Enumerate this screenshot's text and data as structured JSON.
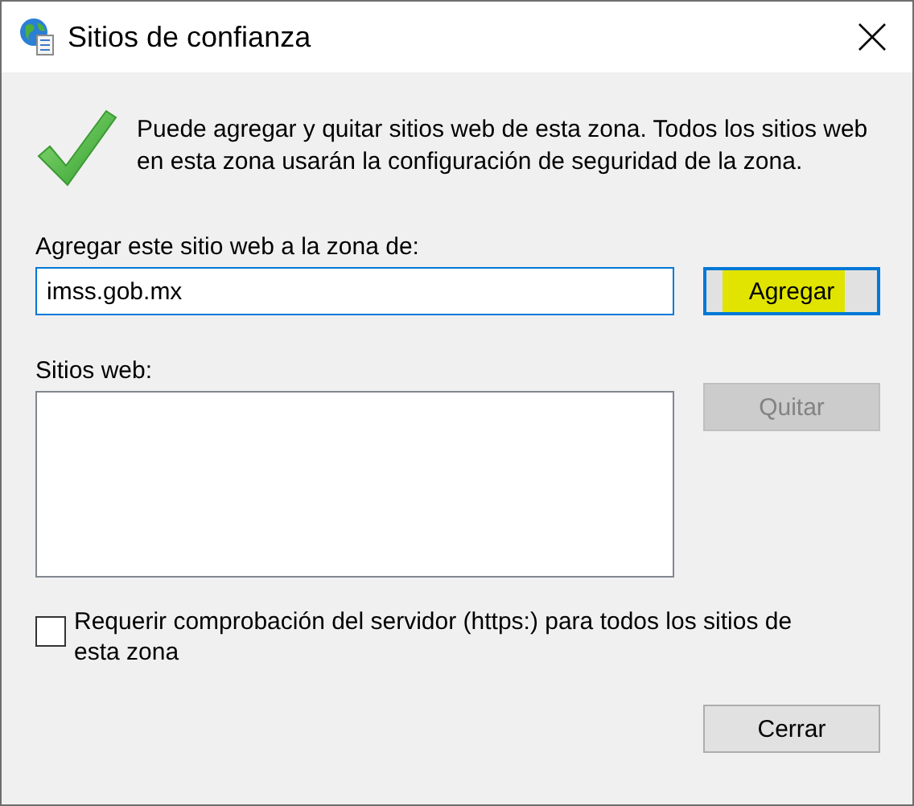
{
  "window": {
    "title": "Sitios de confianza"
  },
  "message": "Puede agregar y quitar sitios web de esta zona. Todos los sitios web en esta zona usarán la configuración de seguridad de la zona.",
  "add_field": {
    "label": "Agregar este sitio web a la zona de:",
    "value": "imss.gob.mx"
  },
  "add_button": {
    "label": "Agregar",
    "highlighted": true,
    "disabled": false
  },
  "sites_list": {
    "label": "Sitios web:"
  },
  "remove_button": {
    "label": "Quitar",
    "disabled": true
  },
  "https_checkbox": {
    "label": "Requerir comprobación del servidor (https:) para todos los sitios de esta zona",
    "checked": false
  },
  "close_button": {
    "label": "Cerrar"
  }
}
